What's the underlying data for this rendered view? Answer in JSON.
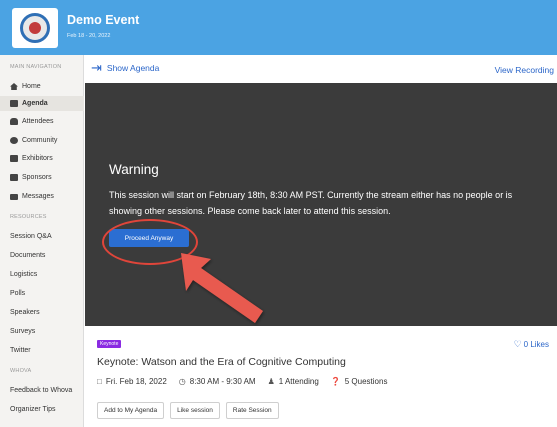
{
  "event": {
    "title": "Demo Event",
    "dates": "Feb 18 - 20, 2022"
  },
  "sidebar": {
    "main_section": "MAIN NAVIGATION",
    "main_items": [
      {
        "label": "Home",
        "icon": "home-icon"
      },
      {
        "label": "Agenda",
        "icon": "calendar-icon"
      },
      {
        "label": "Attendees",
        "icon": "people-icon"
      },
      {
        "label": "Community",
        "icon": "chat-icon"
      },
      {
        "label": "Exhibitors",
        "icon": "building-icon"
      },
      {
        "label": "Sponsors",
        "icon": "document-icon"
      },
      {
        "label": "Messages",
        "icon": "envelope-icon"
      }
    ],
    "resources_section": "RESOURCES",
    "resources_items": [
      "Session Q&A",
      "Documents",
      "Logistics",
      "Polls",
      "Speakers",
      "Surveys",
      "Twitter"
    ],
    "whova_section": "WHOVA",
    "whova_items": [
      "Feedback to Whova",
      "Organizer Tips"
    ]
  },
  "topbar": {
    "show_agenda": "Show Agenda",
    "view_recording": "View Recording"
  },
  "warning": {
    "heading": "Warning",
    "text": "This session will start on February 18th, 8:30 AM PST. Currently the stream either has no people or is showing other sessions. Please come back later to attend this session.",
    "button": "Proceed Anyway"
  },
  "session": {
    "badge": "Keynote",
    "likes": "0 Likes",
    "title": "Keynote: Watson and the Era of Cognitive Computing",
    "date": "Fri. Feb 18, 2022",
    "time": "8:30 AM - 9:30 AM",
    "attending": "1 Attending",
    "questions": "5 Questions",
    "buttons": [
      "Add to My Agenda",
      "Like session",
      "Rate Session"
    ]
  },
  "colors": {
    "header": "#4ba3e3",
    "link": "#2b66c9",
    "button": "#2b6ed2",
    "annotation": "#e0453a",
    "badge": "#8a2be2"
  }
}
